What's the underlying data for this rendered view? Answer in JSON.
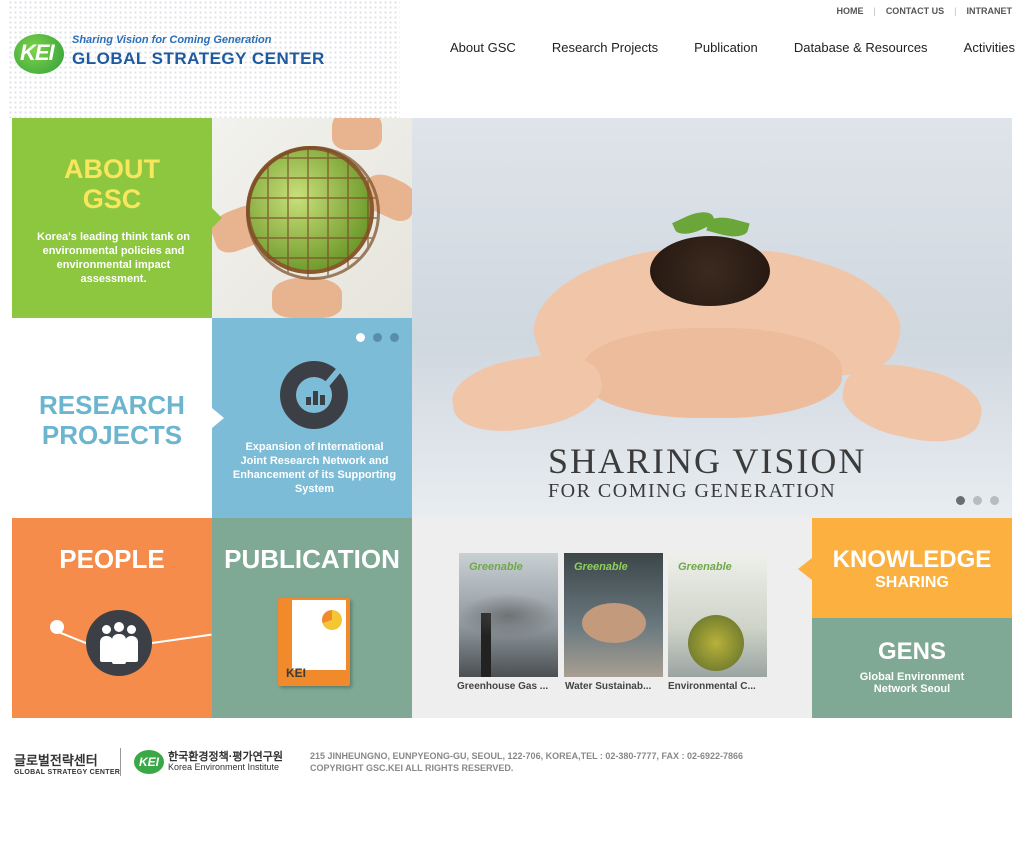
{
  "header": {
    "logo": {
      "mark": "KEI",
      "tagline": "Sharing Vision for Coming Generation",
      "name": "GLOBAL STRATEGY CENTER"
    },
    "utility_nav": [
      "HOME",
      "CONTACT US",
      "INTRANET"
    ],
    "main_nav": [
      "About GSC",
      "Research Projects",
      "Publication",
      "Database & Resources",
      "Activities"
    ]
  },
  "about": {
    "title_line1": "ABOUT",
    "title_line2": "GSC",
    "description": "Korea's leading think tank on environmental policies and environmental impact assessment."
  },
  "research": {
    "title_line1": "RESEARCH",
    "title_line2": "PROJECTS",
    "description": "Expansion of International Joint Research Network and Enhancement of its Supporting System",
    "pager": {
      "count": 3,
      "active": 1
    }
  },
  "hero": {
    "headline": "SHARING VISION",
    "subline": "FOR COMING GENERATION",
    "pager": {
      "count": 3,
      "active": 1
    }
  },
  "people": {
    "title": "PEOPLE"
  },
  "publication": {
    "title": "PUBLICATION",
    "icon_label": "KEI"
  },
  "books": [
    {
      "brand": "Greenable",
      "caption": "Greenhouse Gas ...",
      "color": "#9aa3a8"
    },
    {
      "brand": "Greenable",
      "caption": "Water Sustainab...",
      "color": "#5f6b72"
    },
    {
      "brand": "Greenable",
      "caption": "Environmental C...",
      "color": "#d9dcd4"
    }
  ],
  "knowledge": {
    "title": "KNOWLEDGE",
    "subtitle": "SHARING"
  },
  "gens": {
    "title": "GENS",
    "subtitle_line1": "Global Environment",
    "subtitle_line2": "Network Seoul"
  },
  "footer": {
    "gsc_korean": "글로벌전략센터",
    "gsc_english": "GLOBAL STRATEGY CENTER",
    "kei_mark": "KEI",
    "kei_korean": "한국환경정책·평가연구원",
    "kei_english": "Korea Environment Institute",
    "address": "215 JINHEUNGNO, EUNPYEONG-GU, SEOUL, 122-706, KOREA,TEL : 02-380-7777, FAX : 02-6922-7866",
    "copyright": "COPYRIGHT  GSC.KEI ALL RIGHTS RESERVED."
  },
  "colors": {
    "about_green": "#8dc63f",
    "research_blue": "#7dbcd6",
    "people_orange": "#f58c4b",
    "publication_green": "#7fa995",
    "knowledge_yellow": "#fbb040"
  }
}
